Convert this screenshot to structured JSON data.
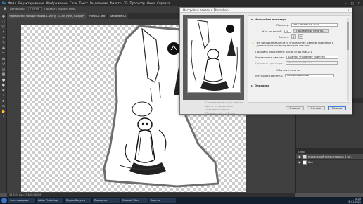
{
  "menu": [
    "Файл",
    "Редактирование",
    "Изображение",
    "Слои",
    "Текст",
    "Выделение",
    "Фильтр",
    "3D",
    "Просмотр",
    "Окно",
    "Справка"
  ],
  "options_bar": {
    "label1": "Автовыбор:",
    "value1": "Группа",
    "label2": "Показать управл. элем."
  },
  "doc_tabs": [
    "зеркальный топор старика-1.psd @ 33,3% (Фон, RGB/8)*",
    "топор-1.psd",
    "Без имени-1"
  ],
  "tools": [
    "move-icon",
    "marquee-icon",
    "lasso-icon",
    "wand-icon",
    "crop-icon",
    "eyedropper-icon",
    "heal-icon",
    "brush-icon",
    "stamp-icon",
    "history-icon",
    "eraser-icon",
    "gradient-icon",
    "blur-icon",
    "dodge-icon",
    "pen-icon",
    "type-icon",
    "path-icon",
    "shape-icon",
    "hand-icon",
    "zoom-icon"
  ],
  "status_text": "33,33%   Док: 7,48M/46,5M",
  "panels": {
    "layers_title": "Слои",
    "layers": [
      "зеркальный топор старика 1 шт.",
      "Фон"
    ],
    "history_title": "История"
  },
  "dialog": {
    "title": "Настройки печати в Photoshop",
    "close": "✕",
    "section_title": "Настройка принтера",
    "printer_label": "Принтер:",
    "printer_value": "HP LaserJet CP 1025",
    "copies_label": "Кол-во копий:",
    "copies_value": "1",
    "printer_settings_btn": "Параметры печати...",
    "layout_label": "Макет:",
    "warning": "Не забудьте включить управление цветом принтера в диалоговом окне параметров печати.",
    "doc_profile": "Профиль документа: sRGB IEC61966-2.1",
    "color_handling_label": "Управление цветом:",
    "color_handling_value": "Цветом управляет принтер",
    "printer_profile_label": "Профиль принтера:",
    "printer_profile_value": "sRGB IEC61966-2.1",
    "normal_print": "Обычная печать",
    "rendering_label": "Метод рендеринга:",
    "rendering_value": "Перцепционный",
    "description_label": "Описание",
    "preview_opts": [
      "Соответствие цвету печати",
      "Цвета за пределами цветового охвата",
      "Показать белую бумагу"
    ],
    "cancel": "Отмена",
    "done": "Готово",
    "print": "Печать"
  },
  "taskbar": [
    "Фото-топорище",
    "Adobe Photoshop",
    "Яндекс.Браузер",
    "Проводник",
    "Microsoft Word",
    "Заметки"
  ],
  "clock": {
    "time": "18:29",
    "date": "28.01.2021"
  }
}
